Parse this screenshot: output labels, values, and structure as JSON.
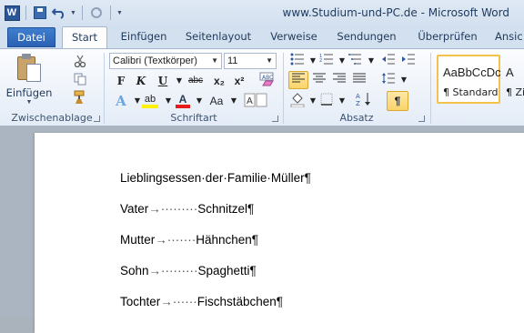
{
  "titlebar": {
    "title": "www.Studium-und-PC.de  -  Microsoft Word"
  },
  "tabs": [
    {
      "label": "Datei"
    },
    {
      "label": "Start"
    },
    {
      "label": "Einfügen"
    },
    {
      "label": "Seitenlayout"
    },
    {
      "label": "Verweise"
    },
    {
      "label": "Sendungen"
    },
    {
      "label": "Überprüfen"
    },
    {
      "label": "Ansic"
    }
  ],
  "ribbon": {
    "clipboard": {
      "paste_label": "Einfügen",
      "group_label": "Zwischenablage"
    },
    "font": {
      "font_name": "Calibri (Textkörper)",
      "font_size": "11",
      "group_label": "Schriftart",
      "bold": "F",
      "italic": "K",
      "underline": "U",
      "strike": "abc",
      "subscript": "x₂",
      "superscript": "x²",
      "grow": "A",
      "shrink": "A",
      "change_case": "Aa",
      "highlight": "ab",
      "font_color": "A",
      "clear": "ABC"
    },
    "paragraph": {
      "group_label": "Absatz",
      "pilcrow": "¶"
    },
    "styles": {
      "sample": "AaBbCcDc",
      "name": "¶ Standard",
      "name2": "¶ Zi",
      "sample2": "A"
    }
  },
  "document": {
    "paragraphs": [
      {
        "text": "Lieblingsessen·der·Familie·Müller¶"
      },
      {
        "left": "Vater",
        "dots": "→·········",
        "right": "Schnitzel¶"
      },
      {
        "left": "Mutter",
        "dots": "→·······",
        "right": "Hähnchen¶"
      },
      {
        "left": "Sohn",
        "dots": "→·········",
        "right": "Spaghetti¶"
      },
      {
        "left": "Tochter",
        "dots": "→······",
        "right": "Fischstäbchen¶"
      }
    ]
  },
  "colors": {
    "accent": "#2b5797",
    "highlight": "#f9d46a",
    "font_color_bar": "#e81b1b",
    "highlight_bar": "#fff200"
  }
}
